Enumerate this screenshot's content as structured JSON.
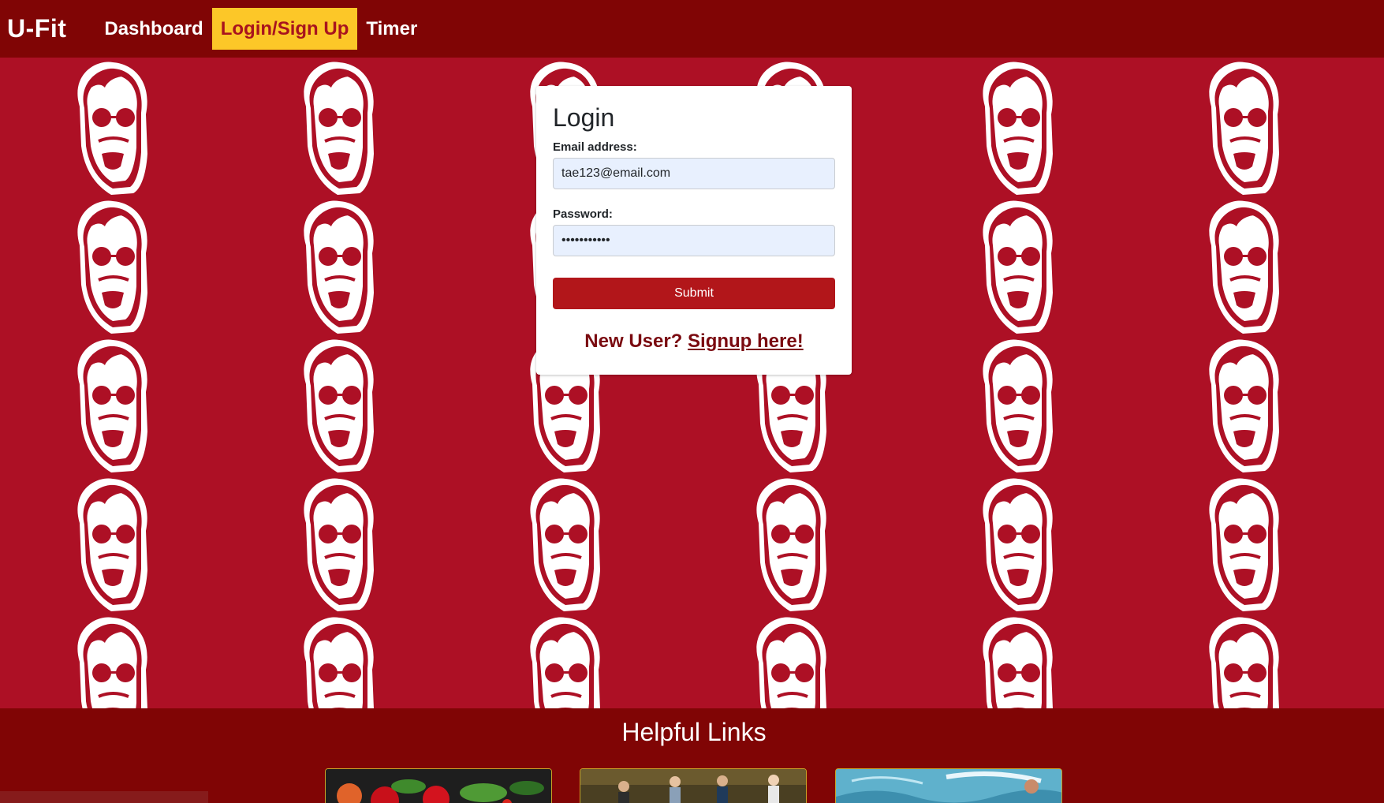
{
  "navbar": {
    "brand": "U-Fit",
    "links": [
      {
        "label": "Dashboard",
        "active": false
      },
      {
        "label": "Login/Sign Up",
        "active": true
      },
      {
        "label": "Timer",
        "active": false
      }
    ]
  },
  "login": {
    "title": "Login",
    "email_label": "Email address:",
    "email_value": "tae123@email.com",
    "password_label": "Password:",
    "password_value": "password123",
    "submit_label": "Submit",
    "new_user_text": "New User?",
    "signup_link": "Signup here!"
  },
  "helpful_links": {
    "title": "Helpful Links",
    "cards": [
      {
        "icon": "vegetables-image"
      },
      {
        "icon": "people-walking-image"
      },
      {
        "icon": "swimmer-image"
      }
    ]
  },
  "colors": {
    "navbar_bg": "#800505",
    "hero_bg": "#ad1025",
    "active_nav_bg": "#fcc728",
    "active_nav_text": "#a8131e",
    "submit_bg": "#b2161a",
    "signup_text": "#7a0a10"
  }
}
